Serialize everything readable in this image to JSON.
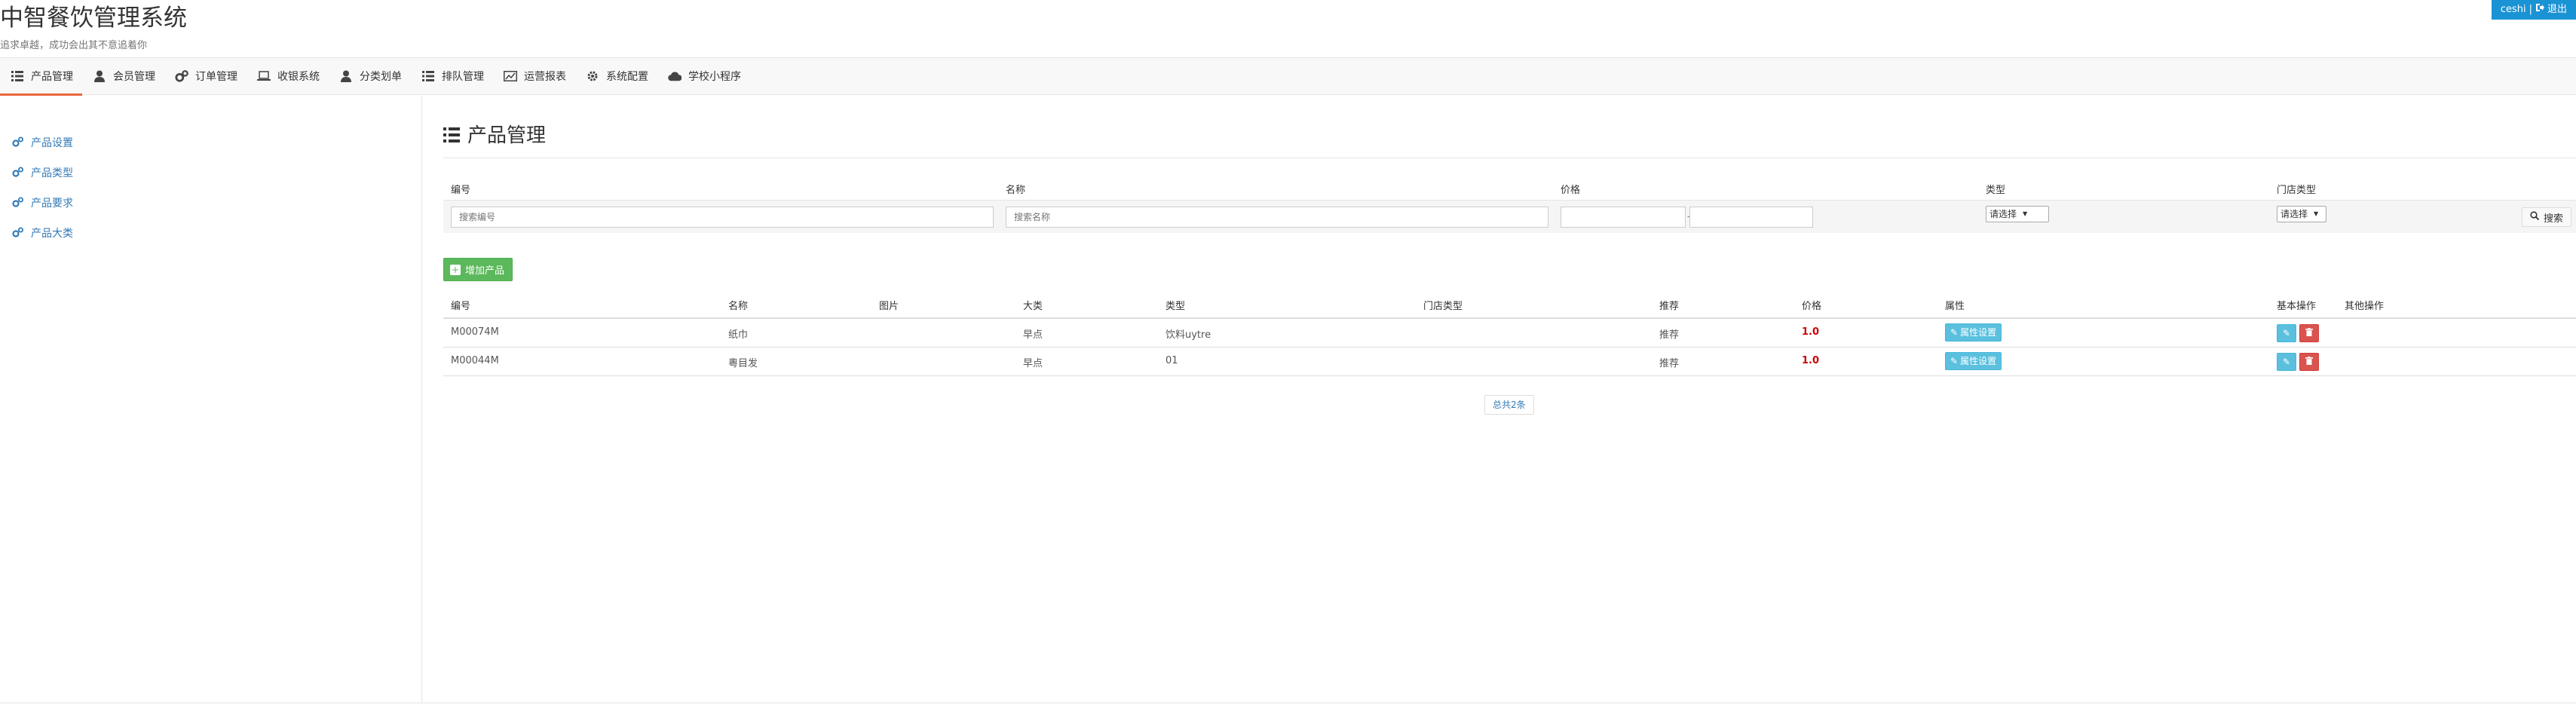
{
  "header": {
    "app_title": "中智餐饮管理系统",
    "slogan": "追求卓越，成功会出其不意追着你",
    "user": "ceshi",
    "separator": "|",
    "logout_label": "退出"
  },
  "nav": {
    "items": [
      {
        "label": "产品管理",
        "icon": "list-icon"
      },
      {
        "label": "会员管理",
        "icon": "user-icon"
      },
      {
        "label": "订单管理",
        "icon": "cogs-icon"
      },
      {
        "label": "收银系统",
        "icon": "laptop-icon"
      },
      {
        "label": "分类划单",
        "icon": "user-icon"
      },
      {
        "label": "排队管理",
        "icon": "list-icon"
      },
      {
        "label": "运营报表",
        "icon": "chart-icon"
      },
      {
        "label": "系统配置",
        "icon": "gear-icon"
      },
      {
        "label": "学校小程序",
        "icon": "cloud-icon"
      }
    ],
    "active_index": 0,
    "accent_color": "#e8663a"
  },
  "sidebar": {
    "items": [
      {
        "label": "产品设置",
        "icon": "cogs-icon"
      },
      {
        "label": "产品类型",
        "icon": "cogs-icon"
      },
      {
        "label": "产品要求",
        "icon": "cogs-icon"
      },
      {
        "label": "产品大类",
        "icon": "cogs-icon"
      }
    ]
  },
  "main": {
    "title": "产品管理",
    "filters": {
      "labels": [
        "编号",
        "名称",
        "价格",
        "类型",
        "门店类型"
      ],
      "code_placeholder": "搜索编号",
      "name_placeholder": "搜索名称",
      "price_separator": "-",
      "type_select": "请选择",
      "store_type_select": "请选择",
      "search_label": "搜索"
    },
    "add_label": "增加产品",
    "table": {
      "columns": [
        "编号",
        "名称",
        "图片",
        "大类",
        "类型",
        "门店类型",
        "推荐",
        "价格",
        "属性",
        "基本操作",
        "其他操作"
      ],
      "rows": [
        {
          "code": "M00074M",
          "name": "纸巾",
          "image": "",
          "category": "早点",
          "type": "饮料uytre",
          "store_type": "",
          "recommend": "推荐",
          "price": "1.0",
          "attr_label": "属性设置"
        },
        {
          "code": "M00044M",
          "name": "粵目发",
          "image": "",
          "category": "早点",
          "type": "01",
          "store_type": "",
          "recommend": "推荐",
          "price": "1.0",
          "attr_label": "属性设置"
        }
      ]
    },
    "pager": "总共2条"
  },
  "colors": {
    "brand_blue": "#1a93d5",
    "success_green": "#5cb85c",
    "info_cyan": "#5bc0de",
    "danger_red": "#d9534f",
    "price_red": "#cc0000",
    "link_blue": "#337ab7"
  }
}
